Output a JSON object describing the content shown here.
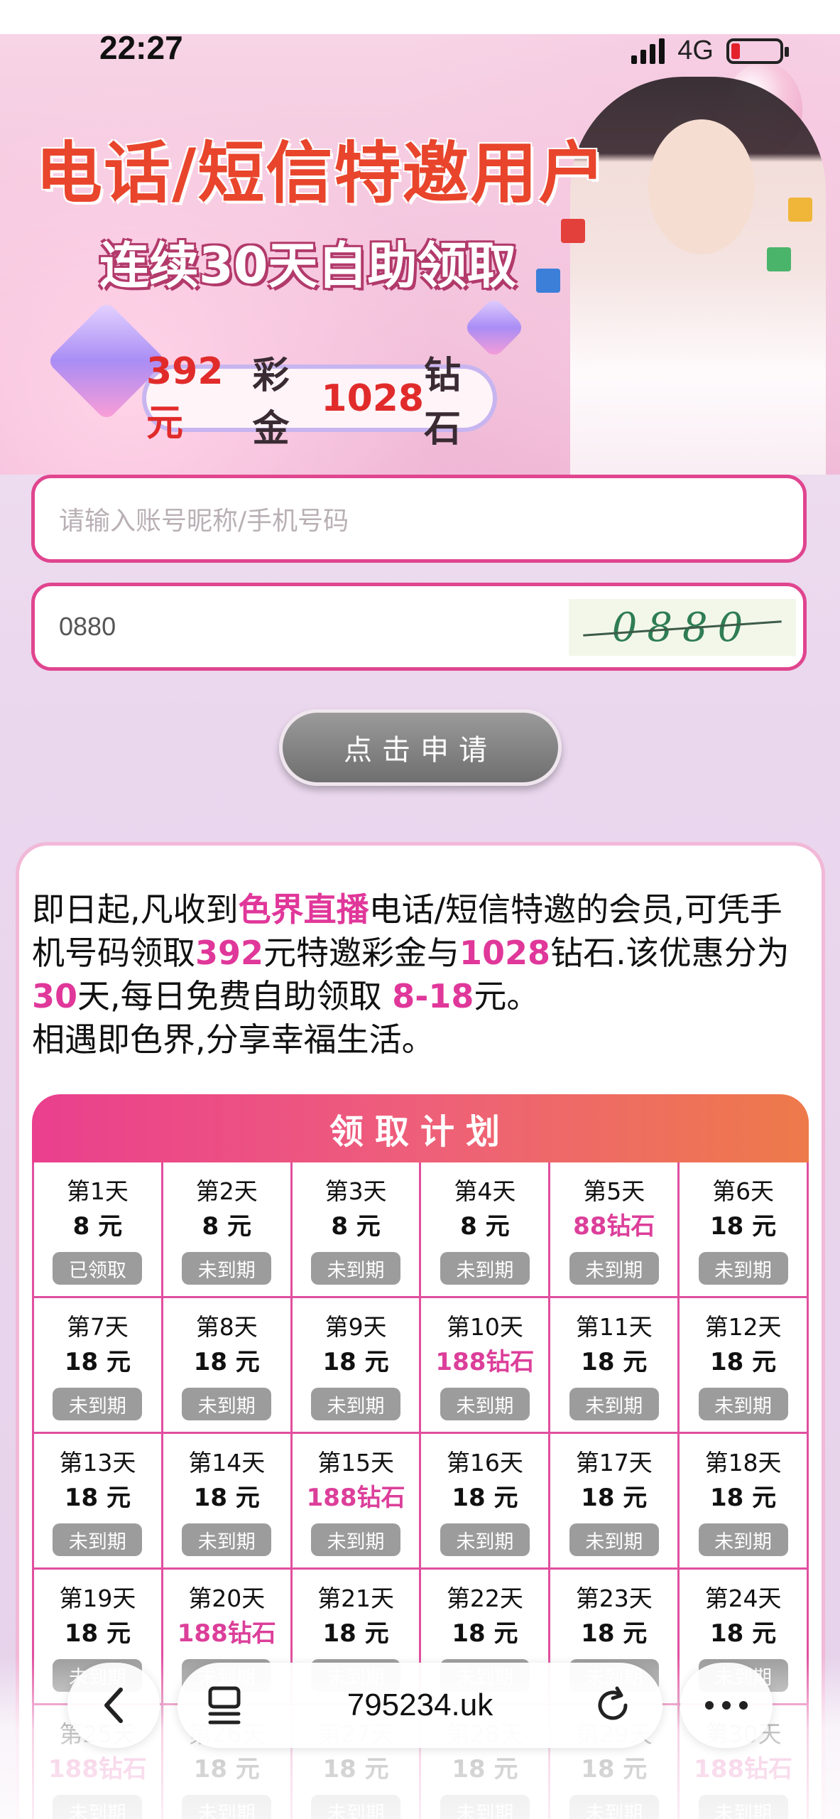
{
  "status": {
    "time": "22:27",
    "network": "4G"
  },
  "banner": {
    "title": "电话/短信特邀用户",
    "subtitle": "连续30天自助领取",
    "pill_amount1": "392元",
    "pill_text1": "彩金",
    "pill_amount2": "1028",
    "pill_text2": "钻石"
  },
  "form": {
    "account_placeholder": "请输入账号昵称/手机号码",
    "captcha_value": "0880",
    "captcha_image_text": "0880",
    "apply_button": "点击申请"
  },
  "intro": {
    "p1": "即日起,凡收到",
    "brand": "色界直播",
    "p2": "电话/短信特邀的会员,可凭手机号码领取",
    "amount": "392",
    "p3": "元特邀彩金与",
    "diamonds": "1028",
    "p4": "钻石.该优惠分为",
    "days": "30",
    "p5": "天,每日免费自助领取 ",
    "range": "8-18",
    "p6": "元。",
    "p7": "相遇即色界,分享幸福生活。"
  },
  "plan": {
    "title": "领取计划",
    "days": [
      {
        "day": "第1天",
        "amount": "8 元",
        "highlight": false,
        "status": "已领取"
      },
      {
        "day": "第2天",
        "amount": "8 元",
        "highlight": false,
        "status": "未到期"
      },
      {
        "day": "第3天",
        "amount": "8 元",
        "highlight": false,
        "status": "未到期"
      },
      {
        "day": "第4天",
        "amount": "8 元",
        "highlight": false,
        "status": "未到期"
      },
      {
        "day": "第5天",
        "amount": "88钻石",
        "highlight": true,
        "status": "未到期"
      },
      {
        "day": "第6天",
        "amount": "18 元",
        "highlight": false,
        "status": "未到期"
      },
      {
        "day": "第7天",
        "amount": "18 元",
        "highlight": false,
        "status": "未到期"
      },
      {
        "day": "第8天",
        "amount": "18 元",
        "highlight": false,
        "status": "未到期"
      },
      {
        "day": "第9天",
        "amount": "18 元",
        "highlight": false,
        "status": "未到期"
      },
      {
        "day": "第10天",
        "amount": "188钻石",
        "highlight": true,
        "status": "未到期"
      },
      {
        "day": "第11天",
        "amount": "18 元",
        "highlight": false,
        "status": "未到期"
      },
      {
        "day": "第12天",
        "amount": "18 元",
        "highlight": false,
        "status": "未到期"
      },
      {
        "day": "第13天",
        "amount": "18 元",
        "highlight": false,
        "status": "未到期"
      },
      {
        "day": "第14天",
        "amount": "18 元",
        "highlight": false,
        "status": "未到期"
      },
      {
        "day": "第15天",
        "amount": "188钻石",
        "highlight": true,
        "status": "未到期"
      },
      {
        "day": "第16天",
        "amount": "18 元",
        "highlight": false,
        "status": "未到期"
      },
      {
        "day": "第17天",
        "amount": "18 元",
        "highlight": false,
        "status": "未到期"
      },
      {
        "day": "第18天",
        "amount": "18 元",
        "highlight": false,
        "status": "未到期"
      },
      {
        "day": "第19天",
        "amount": "18 元",
        "highlight": false,
        "status": "未到期"
      },
      {
        "day": "第20天",
        "amount": "188钻石",
        "highlight": true,
        "status": "未到期"
      },
      {
        "day": "第21天",
        "amount": "18 元",
        "highlight": false,
        "status": "未到期"
      },
      {
        "day": "第22天",
        "amount": "18 元",
        "highlight": false,
        "status": "未到期"
      },
      {
        "day": "第23天",
        "amount": "18 元",
        "highlight": false,
        "status": "未到期"
      },
      {
        "day": "第24天",
        "amount": "18 元",
        "highlight": false,
        "status": "未到期"
      },
      {
        "day": "第25天",
        "amount": "188钻石",
        "highlight": true,
        "status": "未到期"
      },
      {
        "day": "第26天",
        "amount": "18 元",
        "highlight": false,
        "status": "未到期"
      },
      {
        "day": "第27天",
        "amount": "18 元",
        "highlight": false,
        "status": "未到期"
      },
      {
        "day": "第28天",
        "amount": "18 元",
        "highlight": false,
        "status": "未到期"
      },
      {
        "day": "第29天",
        "amount": "18 元",
        "highlight": false,
        "status": "未到期"
      },
      {
        "day": "第30天",
        "amount": "188钻石",
        "highlight": true,
        "status": "未到期"
      }
    ]
  },
  "browser": {
    "url": "795234.uk",
    "icons": [
      "back-icon",
      "tabs-icon",
      "reload-icon",
      "more-icon"
    ]
  },
  "colors": {
    "accent_pink": "#e0458f",
    "highlight_text": "#dc3f9a",
    "header_gradient_end": "#ee7a4a"
  }
}
